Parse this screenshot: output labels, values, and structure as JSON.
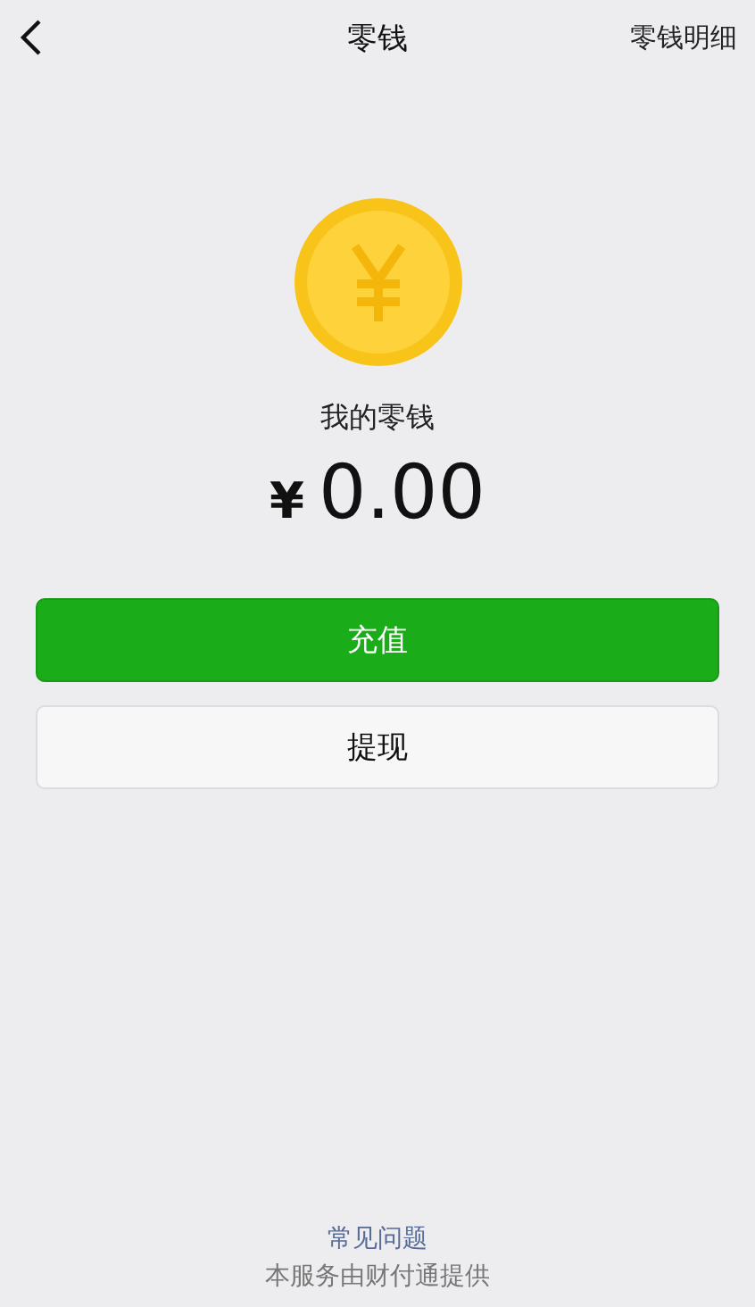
{
  "nav_bar": {
    "title": "零钱",
    "action": "零钱明细"
  },
  "balance": {
    "label": "我的零钱",
    "currency": "¥",
    "amount": "0.00"
  },
  "buttons": [
    {
      "label": "充值",
      "kind": "primary"
    },
    {
      "label": "提现",
      "kind": "secondary"
    }
  ],
  "footer": {
    "link": "常见问题",
    "note": "本服务由财付通提供"
  }
}
